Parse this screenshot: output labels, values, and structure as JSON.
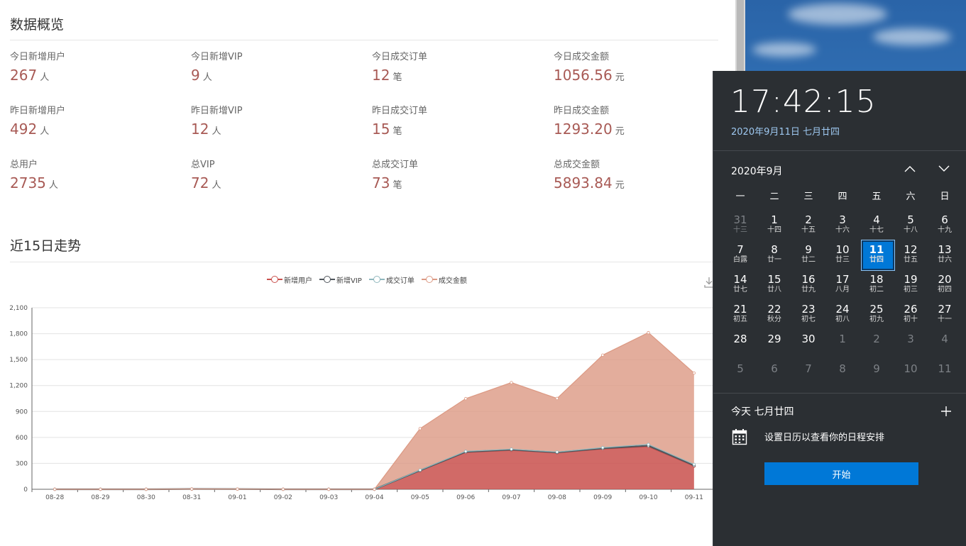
{
  "overview": {
    "title": "数据概览",
    "rows": [
      [
        {
          "label": "今日新增用户",
          "value": "267",
          "unit": "人"
        },
        {
          "label": "今日新增VIP",
          "value": "9",
          "unit": "人"
        },
        {
          "label": "今日成交订单",
          "value": "12",
          "unit": "笔"
        },
        {
          "label": "今日成交金额",
          "value": "1056.56",
          "unit": "元"
        }
      ],
      [
        {
          "label": "昨日新增用户",
          "value": "492",
          "unit": "人"
        },
        {
          "label": "昨日新增VIP",
          "value": "12",
          "unit": "人"
        },
        {
          "label": "昨日成交订单",
          "value": "15",
          "unit": "笔"
        },
        {
          "label": "昨日成交金额",
          "value": "1293.20",
          "unit": "元"
        }
      ],
      [
        {
          "label": "总用户",
          "value": "2735",
          "unit": "人"
        },
        {
          "label": "总VIP",
          "value": "72",
          "unit": "人"
        },
        {
          "label": "总成交订单",
          "value": "73",
          "unit": "笔"
        },
        {
          "label": "总成交金额",
          "value": "5893.84",
          "unit": "元"
        }
      ]
    ]
  },
  "trend": {
    "title": "近15日走势"
  },
  "chart_data": {
    "type": "area",
    "title": "",
    "xlabel": "",
    "ylabel": "",
    "categories": [
      "08-28",
      "08-29",
      "08-30",
      "08-31",
      "09-01",
      "09-02",
      "09-03",
      "09-04",
      "09-05",
      "09-06",
      "09-07",
      "09-08",
      "09-09",
      "09-10",
      "09-11"
    ],
    "ylim": [
      0,
      2100
    ],
    "yticks": [
      0,
      300,
      600,
      900,
      1200,
      1500,
      1800,
      2100
    ],
    "ytick_labels": [
      "0",
      "300",
      "600",
      "900",
      "1,200",
      "1,500",
      "1,800",
      "2,100"
    ],
    "stacked": true,
    "grid": true,
    "legend": "top-center",
    "series": [
      {
        "name": "新增用户",
        "color": "#c9504c",
        "values": [
          0,
          0,
          0,
          3,
          2,
          0,
          0,
          0,
          215,
          425,
          450,
          420,
          465,
          492,
          267
        ]
      },
      {
        "name": "新增VIP",
        "color": "#50565c",
        "values": [
          0,
          0,
          0,
          0,
          0,
          0,
          0,
          0,
          3,
          8,
          8,
          6,
          9,
          12,
          9
        ]
      },
      {
        "name": "成交订单",
        "color": "#8fb7bd",
        "values": [
          0,
          0,
          0,
          0,
          0,
          0,
          0,
          0,
          4,
          6,
          6,
          5,
          8,
          15,
          12
        ]
      },
      {
        "name": "成交金额",
        "color": "#dc9983",
        "values": [
          0,
          0,
          0,
          0,
          0,
          0,
          0,
          0,
          480,
          610,
          770,
          620,
          1070,
          1293,
          1057
        ]
      }
    ]
  },
  "flyout": {
    "time": "17:42:15",
    "date": "2020年9月11日 七月廿四",
    "month_title": "2020年9月",
    "weekdays": [
      "一",
      "二",
      "三",
      "四",
      "五",
      "六",
      "日"
    ],
    "weeks": [
      [
        {
          "n": "31",
          "l": "十三",
          "other": true
        },
        {
          "n": "1",
          "l": "十四"
        },
        {
          "n": "2",
          "l": "十五"
        },
        {
          "n": "3",
          "l": "十六"
        },
        {
          "n": "4",
          "l": "十七"
        },
        {
          "n": "5",
          "l": "十八"
        },
        {
          "n": "6",
          "l": "十九"
        }
      ],
      [
        {
          "n": "7",
          "l": "白露"
        },
        {
          "n": "8",
          "l": "廿一"
        },
        {
          "n": "9",
          "l": "廿二"
        },
        {
          "n": "10",
          "l": "廿三"
        },
        {
          "n": "11",
          "l": "廿四",
          "today": true
        },
        {
          "n": "12",
          "l": "廿五"
        },
        {
          "n": "13",
          "l": "廿六"
        }
      ],
      [
        {
          "n": "14",
          "l": "廿七"
        },
        {
          "n": "15",
          "l": "廿八"
        },
        {
          "n": "16",
          "l": "廿九"
        },
        {
          "n": "17",
          "l": "八月"
        },
        {
          "n": "18",
          "l": "初二"
        },
        {
          "n": "19",
          "l": "初三"
        },
        {
          "n": "20",
          "l": "初四"
        }
      ],
      [
        {
          "n": "21",
          "l": "初五"
        },
        {
          "n": "22",
          "l": "秋分"
        },
        {
          "n": "23",
          "l": "初七"
        },
        {
          "n": "24",
          "l": "初八"
        },
        {
          "n": "25",
          "l": "初九"
        },
        {
          "n": "26",
          "l": "初十"
        },
        {
          "n": "27",
          "l": "十一"
        }
      ],
      [
        {
          "n": "28",
          "l": ""
        },
        {
          "n": "29",
          "l": ""
        },
        {
          "n": "30",
          "l": ""
        },
        {
          "n": "1",
          "l": "",
          "other": true
        },
        {
          "n": "2",
          "l": "",
          "other": true
        },
        {
          "n": "3",
          "l": "",
          "other": true
        },
        {
          "n": "4",
          "l": "",
          "other": true
        }
      ],
      [
        {
          "n": "5",
          "l": "",
          "other": true
        },
        {
          "n": "6",
          "l": "",
          "other": true
        },
        {
          "n": "7",
          "l": "",
          "other": true
        },
        {
          "n": "8",
          "l": "",
          "other": true
        },
        {
          "n": "9",
          "l": "",
          "other": true
        },
        {
          "n": "10",
          "l": "",
          "other": true
        },
        {
          "n": "11",
          "l": "",
          "other": true
        }
      ]
    ],
    "today_label": "今天 七月廿四",
    "agenda_text": "设置日历以查看你的日程安排",
    "start_button": "开始",
    "icons": {
      "prev": "chevron-up-icon",
      "next": "chevron-down-icon",
      "add": "plus-icon",
      "calendar": "calendar-icon",
      "download": "download-icon"
    }
  }
}
